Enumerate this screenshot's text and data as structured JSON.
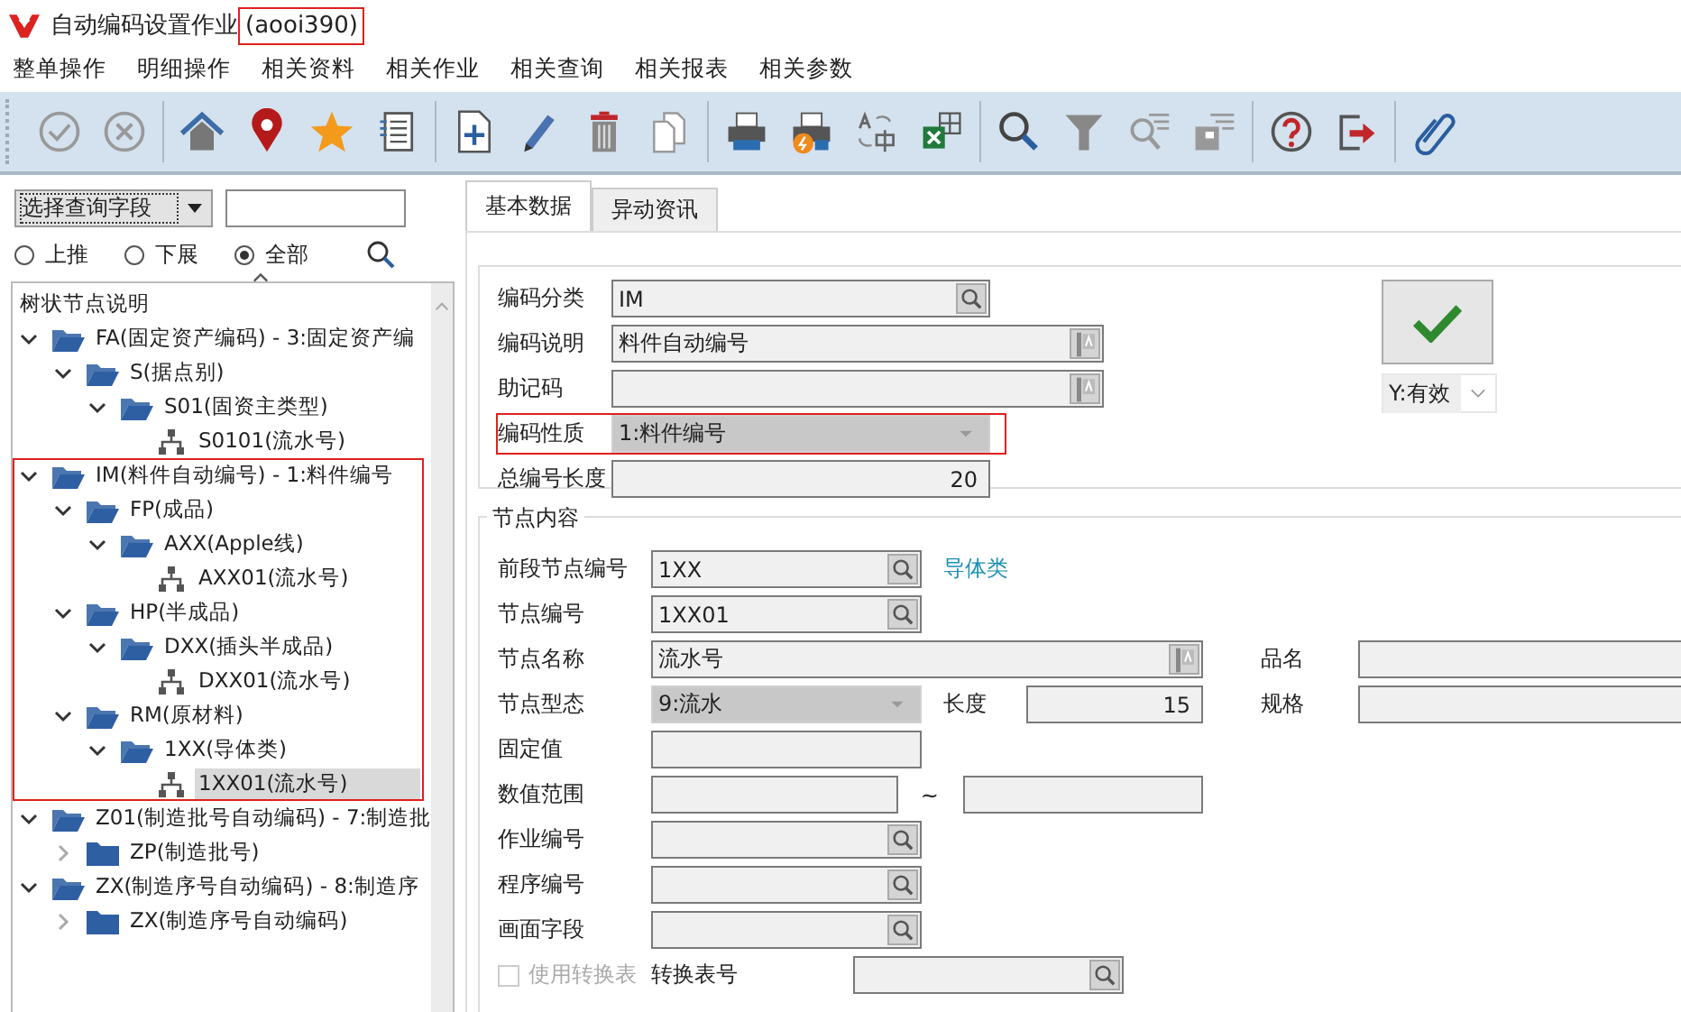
{
  "window": {
    "title": "自动编码设置作业",
    "code": "(aooi390)",
    "code_highlighted": true
  },
  "menu": [
    "整单操作",
    "明细操作",
    "相关资料",
    "相关作业",
    "相关查询",
    "相关报表",
    "相关参数"
  ],
  "query": {
    "field_select": "选择查询字段",
    "radios": [
      {
        "label": "上推",
        "selected": false
      },
      {
        "label": "下展",
        "selected": false
      },
      {
        "label": "全部",
        "selected": true
      }
    ]
  },
  "tree": {
    "header": "树状节点说明",
    "nodes": [
      {
        "label": "FA(固定资产编码) - 3:固定资产编",
        "kind": "folder",
        "expanded": true,
        "selected": false,
        "children": [
          {
            "label": "S(据点别)",
            "kind": "folder",
            "expanded": true,
            "selected": false,
            "children": [
              {
                "label": "S01(固资主类型)",
                "kind": "folder",
                "expanded": true,
                "selected": false,
                "children": [
                  {
                    "label": "S0101(流水号)",
                    "kind": "leaf",
                    "selected": false
                  }
                ]
              }
            ]
          }
        ]
      },
      {
        "label": "IM(料件自动编号) - 1:料件编号",
        "kind": "folder",
        "expanded": true,
        "selected": false,
        "highlighted": true,
        "children": [
          {
            "label": "FP(成品)",
            "kind": "folder",
            "expanded": true,
            "selected": false,
            "children": [
              {
                "label": "AXX(Apple线)",
                "kind": "folder",
                "expanded": true,
                "selected": false,
                "children": [
                  {
                    "label": "AXX01(流水号)",
                    "kind": "leaf",
                    "selected": false
                  }
                ]
              }
            ]
          },
          {
            "label": "HP(半成品)",
            "kind": "folder",
            "expanded": true,
            "selected": false,
            "children": [
              {
                "label": "DXX(插头半成品)",
                "kind": "folder",
                "expanded": true,
                "selected": false,
                "children": [
                  {
                    "label": "DXX01(流水号)",
                    "kind": "leaf",
                    "selected": false
                  }
                ]
              }
            ]
          },
          {
            "label": "RM(原材料)",
            "kind": "folder",
            "expanded": true,
            "selected": false,
            "children": [
              {
                "label": "1XX(导体类)",
                "kind": "folder",
                "expanded": true,
                "selected": false,
                "children": [
                  {
                    "label": "1XX01(流水号)",
                    "kind": "leaf",
                    "selected": true
                  }
                ]
              }
            ]
          }
        ]
      },
      {
        "label": "Z01(制造批号自动编码) - 7:制造批",
        "kind": "folder",
        "expanded": true,
        "selected": false,
        "children": [
          {
            "label": "ZP(制造批号)",
            "kind": "folder",
            "expanded": false,
            "selected": false
          }
        ]
      },
      {
        "label": "ZX(制造序号自动编码) - 8:制造序",
        "kind": "folder",
        "expanded": true,
        "selected": false,
        "children": [
          {
            "label": "ZX(制造序号自动编码)",
            "kind": "folder",
            "expanded": false,
            "selected": false
          }
        ]
      }
    ]
  },
  "tabs": [
    {
      "label": "基本数据",
      "selected": true
    },
    {
      "label": "异动资讯",
      "selected": false
    }
  ],
  "basic": {
    "fields": [
      {
        "label": "编码分类",
        "kind": "lookup",
        "value": "IM"
      },
      {
        "label": "编码说明",
        "kind": "lang",
        "value": "料件自动编号"
      },
      {
        "label": "助记码",
        "kind": "lang"
      },
      {
        "label": "编码性质",
        "kind": "select",
        "value": "1:料件编号",
        "highlighted": true
      },
      {
        "label": "总编号长度",
        "kind": "number",
        "value": "20"
      }
    ],
    "status": "Y:有效"
  },
  "node_content": {
    "title": "节点内容",
    "rows": [
      {
        "label": "前段节点编号",
        "field": {
          "kind": "lookup",
          "value": "1XX"
        },
        "link": "导体类"
      },
      {
        "label": "节点编号",
        "field": {
          "kind": "lookup",
          "value": "1XX01"
        }
      },
      {
        "label": "节点名称",
        "field": {
          "kind": "lang",
          "value": "流水号"
        },
        "side": {
          "label": "品名"
        }
      },
      {
        "label": "节点型态",
        "field": {
          "kind": "select",
          "value": "9:流水"
        },
        "mid": {
          "label": "长度",
          "kind": "number",
          "value": "15"
        },
        "side": {
          "label": "规格"
        }
      },
      {
        "label": "固定值",
        "field": {
          "kind": "plain"
        }
      },
      {
        "label": "数值范围",
        "field": {
          "kind": "plain"
        },
        "range_to": {
          "label": "~",
          "kind": "plain"
        }
      },
      {
        "label": "作业编号",
        "field": {
          "kind": "lookup"
        }
      },
      {
        "label": "程序编号",
        "field": {
          "kind": "lookup"
        }
      },
      {
        "label": "画面字段",
        "field": {
          "kind": "lookup"
        }
      }
    ],
    "conversion": {
      "checkbox": {
        "label": "使用转换表",
        "checked": false,
        "disabled": true
      },
      "label": "转换表号",
      "field": {
        "kind": "lookup"
      }
    }
  }
}
